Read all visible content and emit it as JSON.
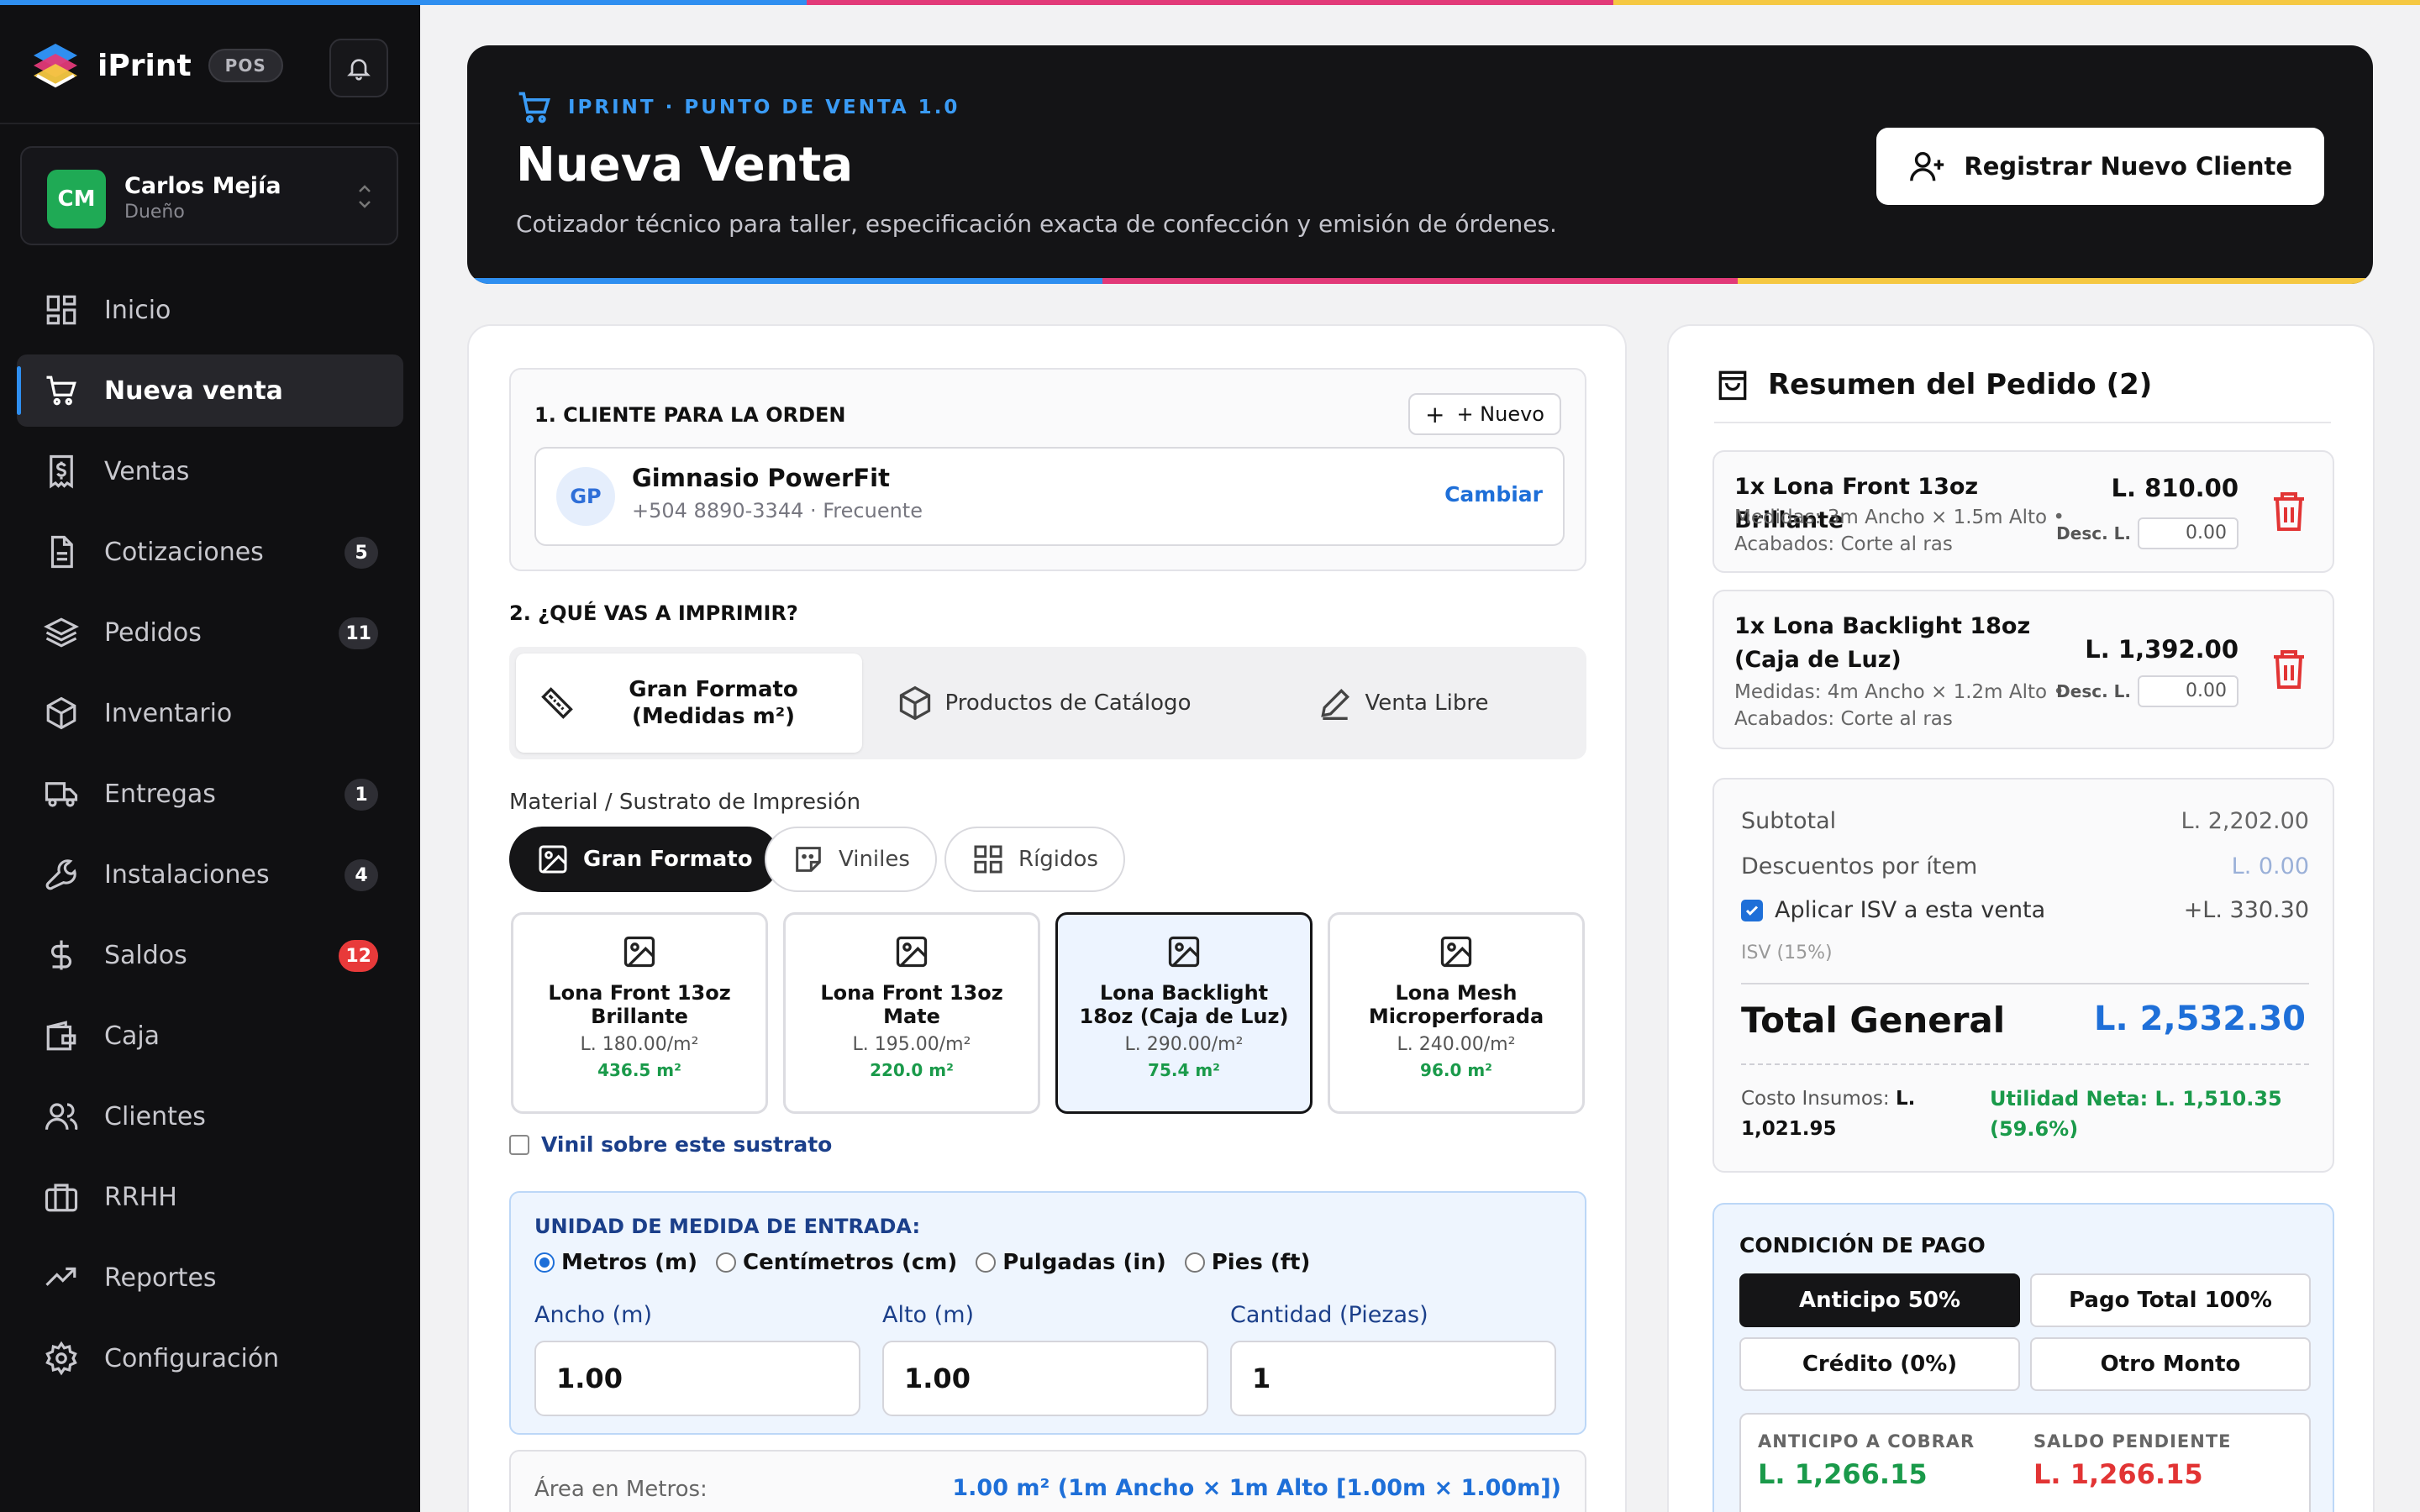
{
  "colors": {
    "blue": "#2f8ff0",
    "magenta": "#e23a78",
    "yellow": "#f5c842",
    "green": "#1a9a4a",
    "red": "#e83a3a"
  },
  "sidebar": {
    "brand": "iPrint",
    "pos_badge": "POS",
    "user": {
      "initials": "CM",
      "name": "Carlos Mejía",
      "role": "Dueño"
    },
    "items": [
      {
        "label": "Inicio",
        "icon": "dashboard-icon",
        "badge": ""
      },
      {
        "label": "Nueva venta",
        "icon": "cart-icon",
        "badge": "",
        "active": true
      },
      {
        "label": "Ventas",
        "icon": "receipt-icon",
        "badge": ""
      },
      {
        "label": "Cotizaciones",
        "icon": "document-icon",
        "badge": "5"
      },
      {
        "label": "Pedidos",
        "icon": "layers-icon",
        "badge": "11"
      },
      {
        "label": "Inventario",
        "icon": "box-icon",
        "badge": ""
      },
      {
        "label": "Entregas",
        "icon": "truck-icon",
        "badge": "1"
      },
      {
        "label": "Instalaciones",
        "icon": "wrench-icon",
        "badge": "4"
      },
      {
        "label": "Saldos",
        "icon": "dollar-icon",
        "badge": "12"
      },
      {
        "label": "Caja",
        "icon": "wallet-icon",
        "badge": ""
      },
      {
        "label": "Clientes",
        "icon": "users-icon",
        "badge": ""
      },
      {
        "label": "RRHH",
        "icon": "briefcase-icon",
        "badge": ""
      },
      {
        "label": "Reportes",
        "icon": "trend-icon",
        "badge": ""
      },
      {
        "label": "Configuración",
        "icon": "gear-icon",
        "badge": ""
      }
    ]
  },
  "header": {
    "eyebrow": "IPRINT · PUNTO DE VENTA 1.0",
    "title": "Nueva Venta",
    "subtitle": "Cotizador técnico para taller, especificación exacta de confección y emisión de órdenes.",
    "register_button": "Registrar Nuevo Cliente"
  },
  "client": {
    "section_title": "1. CLIENTE PARA LA ORDEN",
    "new_button": "+ Nuevo",
    "initials": "GP",
    "name": "Gimnasio PowerFit",
    "details": "+504 8890-3344 · Frecuente",
    "change": "Cambiar"
  },
  "print": {
    "section_title": "2. ¿QUÉ VAS A IMPRIMIR?",
    "tabs": [
      "Gran Formato (Medidas m²)",
      "Productos de Catálogo",
      "Venta Libre"
    ],
    "material_label": "Material / Sustrato de Impresión",
    "categories": [
      "Gran Formato",
      "Viniles",
      "Rígidos"
    ],
    "materials": [
      {
        "name": "Lona Front 13oz Brillante",
        "price": "L. 180.00/m²",
        "stock": "436.5 m²"
      },
      {
        "name": "Lona Front 13oz Mate",
        "price": "L. 195.00/m²",
        "stock": "220.0 m²"
      },
      {
        "name": "Lona Backlight 18oz (Caja de Luz)",
        "price": "L. 290.00/m²",
        "stock": "75.4 m²"
      },
      {
        "name": "Lona Mesh Microperforada",
        "price": "L. 240.00/m²",
        "stock": "96.0 m²"
      }
    ],
    "vinyl_option": "Vinil sobre este sustrato"
  },
  "units": {
    "title": "UNIDAD DE MEDIDA DE ENTRADA:",
    "options": [
      "Metros (m)",
      "Centímetros (cm)",
      "Pulgadas (in)",
      "Pies (ft)"
    ],
    "width_label": "Ancho (m)",
    "height_label": "Alto (m)",
    "qty_label": "Cantidad (Piezas)",
    "width": "1.00",
    "height": "1.00",
    "qty": "1"
  },
  "area": {
    "label": "Área en Metros:",
    "value": "1.00 m² (1m Ancho × 1m Alto [1.00m × 1.00m])"
  },
  "summary": {
    "title": "Resumen del Pedido (2)",
    "items": [
      {
        "name": "1x Lona Front 13oz Brillante",
        "details": "Medidas: 3m Ancho × 1.5m Alto • Acabados: Corte al ras",
        "price": "L. 810.00",
        "disc_label": "Desc. L.",
        "disc": "0.00"
      },
      {
        "name": "1x Lona Backlight 18oz (Caja de Luz)",
        "details": "Medidas: 4m Ancho × 1.2m Alto • Acabados: Corte al ras",
        "price": "L. 1,392.00",
        "disc_label": "Desc. L.",
        "disc": "0.00"
      }
    ],
    "subtotal_label": "Subtotal",
    "subtotal": "L. 2,202.00",
    "discounts_label": "Descuentos por ítem",
    "discounts": "L. 0.00",
    "isv_label": "Aplicar ISV a esta venta",
    "isv_value": "+L. 330.30",
    "isv_note": "ISV (15%)",
    "total_label": "Total General",
    "total": "L. 2,532.30",
    "cost_label": "Costo Insumos:",
    "cost_value": "L. 1,021.95",
    "utility": "Utilidad Neta: L. 1,510.35 (59.6%)"
  },
  "payment": {
    "title": "CONDICIÓN DE PAGO",
    "options": [
      "Anticipo 50%",
      "Pago Total 100%",
      "Crédito (0%)",
      "Otro Monto"
    ],
    "advance_label": "ANTICIPO A COBRAR",
    "advance": "L. 1,266.15",
    "pending_label": "SALDO PENDIENTE",
    "pending": "L. 1,266.15"
  }
}
